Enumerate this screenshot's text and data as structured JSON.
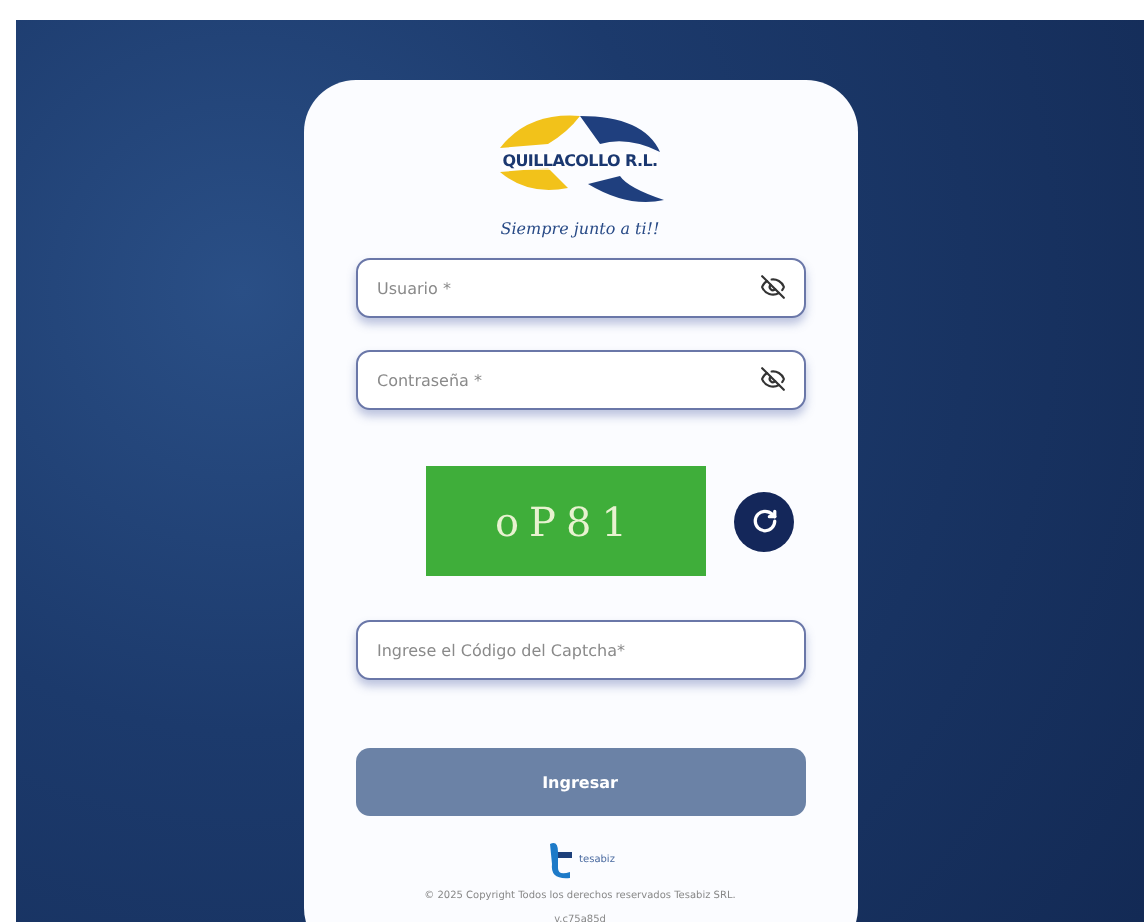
{
  "logo": {
    "name": "QUILLACOLLO R.L.",
    "tagline": "Siempre junto a ti!!"
  },
  "fields": [
    {
      "placeholder": "Usuario *",
      "kind": "secret"
    },
    {
      "placeholder": "Contraseña *",
      "kind": "secret"
    },
    {
      "placeholder": "Ingrese el Código del Captcha*",
      "kind": "plain"
    }
  ],
  "captcha": {
    "code": "oP81"
  },
  "submit": {
    "label": "Ingresar",
    "disabled": true
  },
  "footer": {
    "brand": "tesabiz",
    "copyright": "© 2025 Copyright Todos los derechos reservados Tesabiz SRL.",
    "version": "v.c75a85d"
  }
}
